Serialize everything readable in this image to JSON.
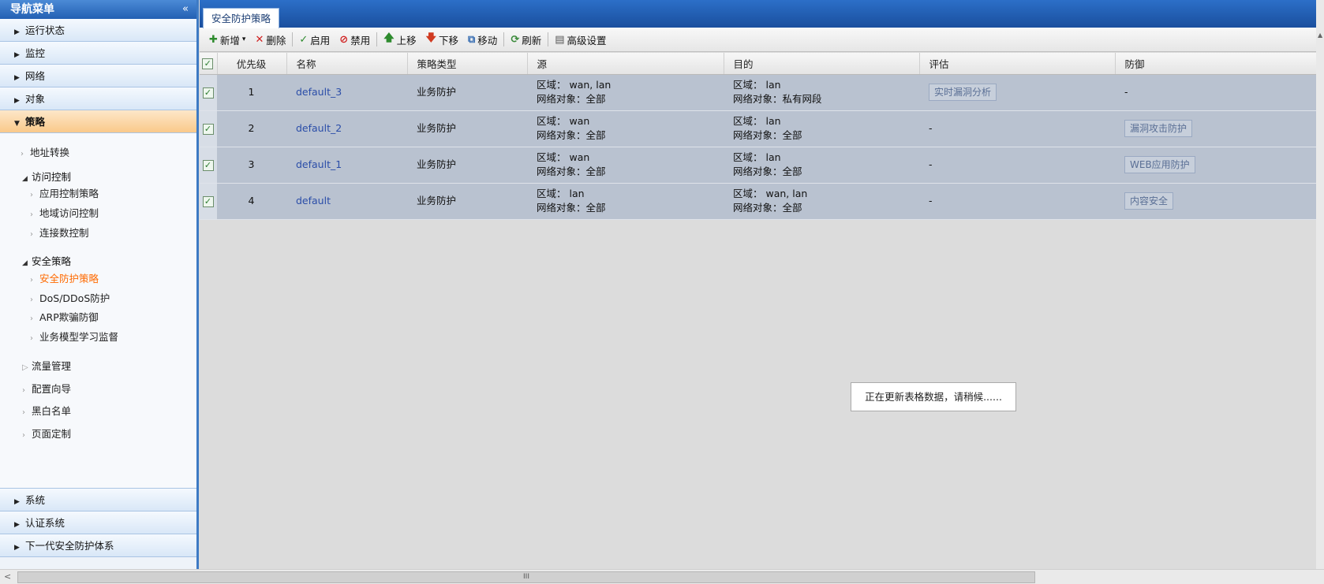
{
  "nav": {
    "title": "导航菜单",
    "collapse": "«",
    "sections_top": [
      "运行状态",
      "监控",
      "网络",
      "对象"
    ],
    "active_section": "策略",
    "policy_items": {
      "nat": "地址转换",
      "access_control": "访问控制",
      "app_control": "应用控制策略",
      "geo_access": "地域访问控制",
      "conn_control": "连接数控制",
      "security_policy": "安全策略",
      "security_protect": "安全防护策略",
      "dos": "DoS/DDoS防护",
      "arp": "ARP欺骗防御",
      "biz_model": "业务模型学习监督",
      "traffic": "流量管理",
      "wizard": "配置向导",
      "blackwhite": "黑白名单",
      "page_custom": "页面定制"
    },
    "sections_bottom": [
      "系统",
      "认证系统",
      "下一代安全防护体系"
    ]
  },
  "tab": {
    "active": "安全防护策略"
  },
  "toolbar": {
    "add": "新增",
    "delete": "删除",
    "enable": "启用",
    "disable": "禁用",
    "move_up": "上移",
    "move_down": "下移",
    "move": "移动",
    "refresh": "刷新",
    "advanced": "高级设置"
  },
  "columns": [
    "优先级",
    "名称",
    "策略类型",
    "源",
    "目的",
    "评估",
    "防御"
  ],
  "rows": [
    {
      "priority": "1",
      "name": "default_3",
      "type": "业务防护",
      "src_zone": "区域： wan, lan",
      "src_obj": "网络对象：全部",
      "dst_zone": "区域： lan",
      "dst_obj": "网络对象：私有网段",
      "eval": "实时漏洞分析",
      "defense": "-"
    },
    {
      "priority": "2",
      "name": "default_2",
      "type": "业务防护",
      "src_zone": "区域： wan",
      "src_obj": "网络对象：全部",
      "dst_zone": "区域： lan",
      "dst_obj": "网络对象：全部",
      "eval": "-",
      "defense": "漏洞攻击防护"
    },
    {
      "priority": "3",
      "name": "default_1",
      "type": "业务防护",
      "src_zone": "区域： wan",
      "src_obj": "网络对象：全部",
      "dst_zone": "区域： lan",
      "dst_obj": "网络对象：全部",
      "eval": "-",
      "defense": "WEB应用防护"
    },
    {
      "priority": "4",
      "name": "default",
      "type": "业务防护",
      "src_zone": "区域： lan",
      "src_obj": "网络对象：全部",
      "dst_zone": "区域： wan, lan",
      "dst_obj": "网络对象：全部",
      "eval": "-",
      "defense": "内容安全"
    }
  ],
  "loading_text": "正在更新表格数据，请稍候......",
  "scroll": {
    "grip": "III",
    "left_arrow": "<"
  }
}
